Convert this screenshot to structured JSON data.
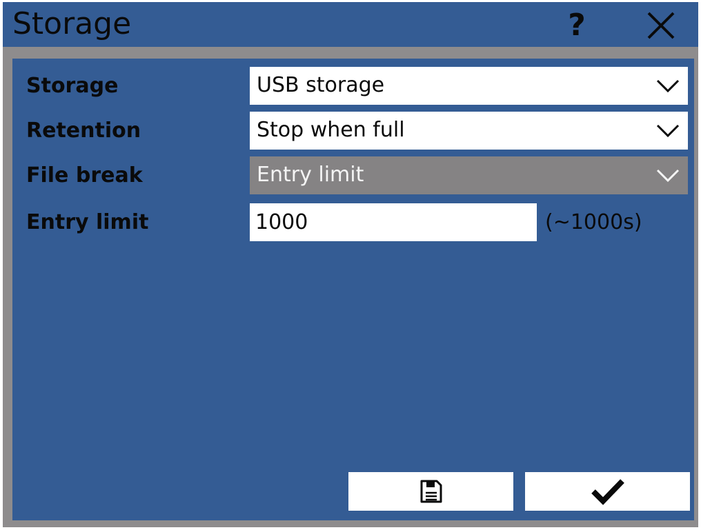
{
  "dialog": {
    "title": "Storage",
    "help_label": "?",
    "close_icon": "close-icon"
  },
  "fields": [
    {
      "label": "Storage",
      "value": "USB storage",
      "enabled": true
    },
    {
      "label": "Retention",
      "value": "Stop when full",
      "enabled": true
    },
    {
      "label": "File break",
      "value": "Entry limit",
      "enabled": false
    }
  ],
  "entry_limit": {
    "label": "Entry limit",
    "value": "1000",
    "hint": "(~1000s)"
  },
  "buttons": {
    "save_icon": "floppy-disk-icon",
    "confirm_icon": "checkmark-icon"
  },
  "colors": {
    "title_bar": "#345c94",
    "panel": "#345c94",
    "frame": "#8e8c8d",
    "disabled_select": "#858384"
  }
}
